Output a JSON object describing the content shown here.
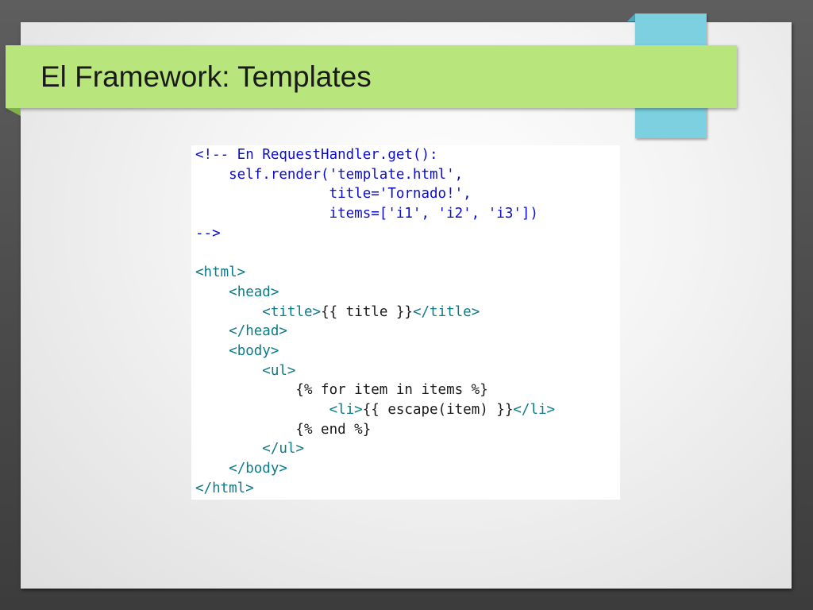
{
  "slide": {
    "title": "El Framework: Templates"
  },
  "colors": {
    "title_bar": "#b8e57c",
    "accent_tab": "#7dd0e0",
    "comment": "#0c0ccc",
    "tag": "#0b7b8a",
    "text": "#1a1a1a"
  },
  "code": {
    "lines": [
      [
        {
          "t": "c",
          "v": "<!-- En RequestHandler.get():"
        }
      ],
      [
        {
          "t": "c",
          "v": "    self.render('template.html',"
        }
      ],
      [
        {
          "t": "c",
          "v": "                title='Tornado!',"
        }
      ],
      [
        {
          "t": "c",
          "v": "                items=['i1', 'i2', 'i3'])"
        }
      ],
      [
        {
          "t": "c",
          "v": "-->"
        }
      ],
      [],
      [
        {
          "t": "g",
          "v": "<html>"
        }
      ],
      [
        {
          "t": "x",
          "v": "    "
        },
        {
          "t": "g",
          "v": "<head>"
        }
      ],
      [
        {
          "t": "x",
          "v": "        "
        },
        {
          "t": "g",
          "v": "<title>"
        },
        {
          "t": "x",
          "v": "{{ title }}"
        },
        {
          "t": "g",
          "v": "</title>"
        }
      ],
      [
        {
          "t": "x",
          "v": "    "
        },
        {
          "t": "g",
          "v": "</head>"
        }
      ],
      [
        {
          "t": "x",
          "v": "    "
        },
        {
          "t": "g",
          "v": "<body>"
        }
      ],
      [
        {
          "t": "x",
          "v": "        "
        },
        {
          "t": "g",
          "v": "<ul>"
        }
      ],
      [
        {
          "t": "x",
          "v": "            {% for item in items %}"
        }
      ],
      [
        {
          "t": "x",
          "v": "                "
        },
        {
          "t": "g",
          "v": "<li>"
        },
        {
          "t": "x",
          "v": "{{ escape(item) }}"
        },
        {
          "t": "g",
          "v": "</li>"
        }
      ],
      [
        {
          "t": "x",
          "v": "            {% end %}"
        }
      ],
      [
        {
          "t": "x",
          "v": "        "
        },
        {
          "t": "g",
          "v": "</ul>"
        }
      ],
      [
        {
          "t": "x",
          "v": "    "
        },
        {
          "t": "g",
          "v": "</body>"
        }
      ],
      [
        {
          "t": "g",
          "v": "</html>"
        }
      ]
    ]
  }
}
